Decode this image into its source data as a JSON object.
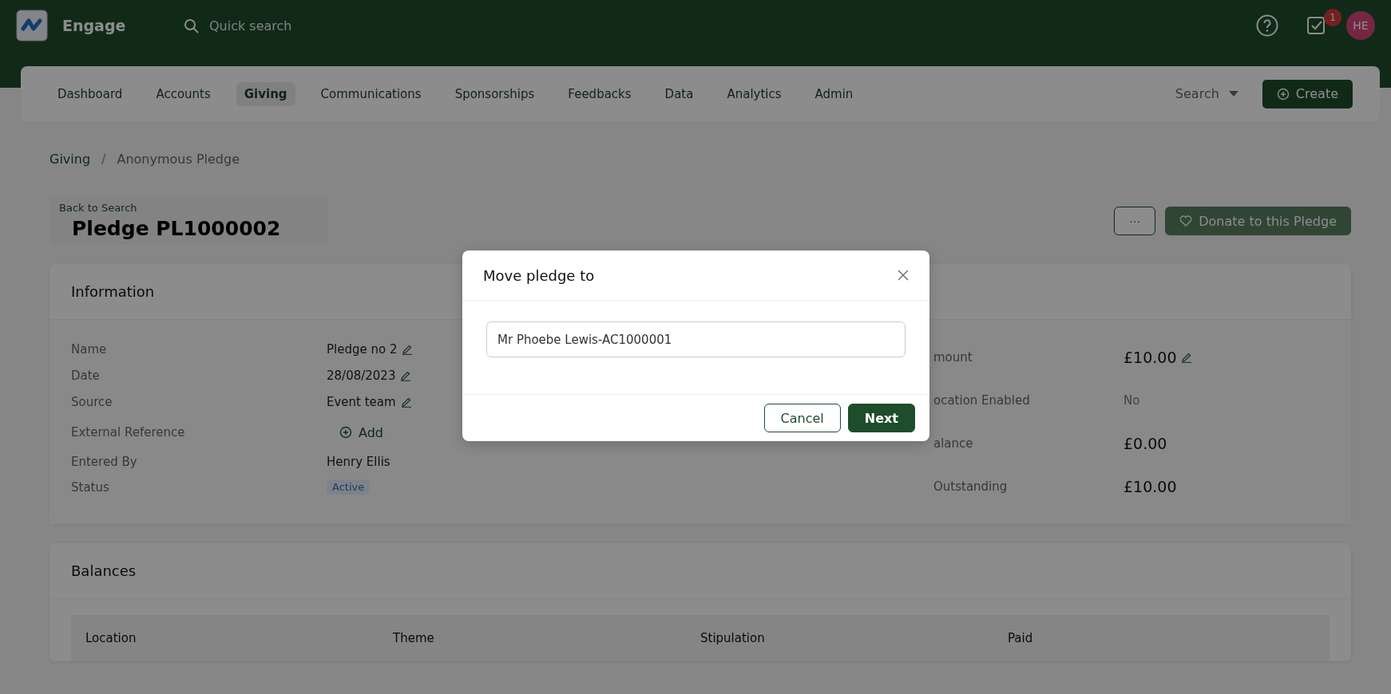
{
  "app": {
    "name": "Engage",
    "search_placeholder": "Quick search",
    "notification_count": "1",
    "avatar": "HE"
  },
  "nav": [
    {
      "label": "Dashboard",
      "selected": false
    },
    {
      "label": "Accounts",
      "selected": false
    },
    {
      "label": "Giving",
      "selected": true
    },
    {
      "label": "Communications",
      "selected": false
    },
    {
      "label": "Sponsorships",
      "selected": false
    },
    {
      "label": "Feedbacks",
      "selected": false
    },
    {
      "label": "Data",
      "selected": false
    },
    {
      "label": "Analytics",
      "selected": false
    },
    {
      "label": "Admin",
      "selected": false
    }
  ],
  "nav_search": "Search",
  "create_button": "Create",
  "breadcrumb": [
    "Giving",
    "Anonymous Pledge"
  ],
  "breadcrumb_separator": "/",
  "back_link": "Back to Search",
  "title": "Pledge PL1000002",
  "more_button": "···",
  "donate_button": "Donate to this Pledge",
  "information": {
    "title": "Information",
    "left": [
      {
        "label": "Name",
        "value": "Pledge no 2",
        "kind": "editable"
      },
      {
        "label": "Date",
        "value": "28/08/2023",
        "kind": "editable"
      },
      {
        "label": "Source",
        "value": "Event team",
        "kind": "editable"
      },
      {
        "label": "External Reference",
        "value": "Add",
        "kind": "add"
      },
      {
        "label": "Entered By",
        "value": "Henry Ellis",
        "kind": "plain"
      },
      {
        "label": "Status",
        "value": "Active",
        "kind": "badge"
      }
    ],
    "right": [
      {
        "label": "mount",
        "value": "£10.00",
        "kind": "editable"
      },
      {
        "label": "ocation Enabled",
        "value": "No",
        "kind": "muted"
      },
      {
        "label": "alance",
        "value": "£0.00",
        "kind": "plain"
      },
      {
        "label": "Outstanding",
        "value": "£10.00",
        "kind": "plain"
      }
    ]
  },
  "balances": {
    "title": "Balances",
    "columns": [
      "Location",
      "Theme",
      "Stipulation",
      "Paid"
    ]
  },
  "modal": {
    "title": "Move pledge to",
    "value": "Mr Phoebe Lewis-AC1000001",
    "buttons": [
      {
        "label": "Cancel",
        "kind": "secondary"
      },
      {
        "label": "Next",
        "kind": "primary"
      }
    ]
  }
}
